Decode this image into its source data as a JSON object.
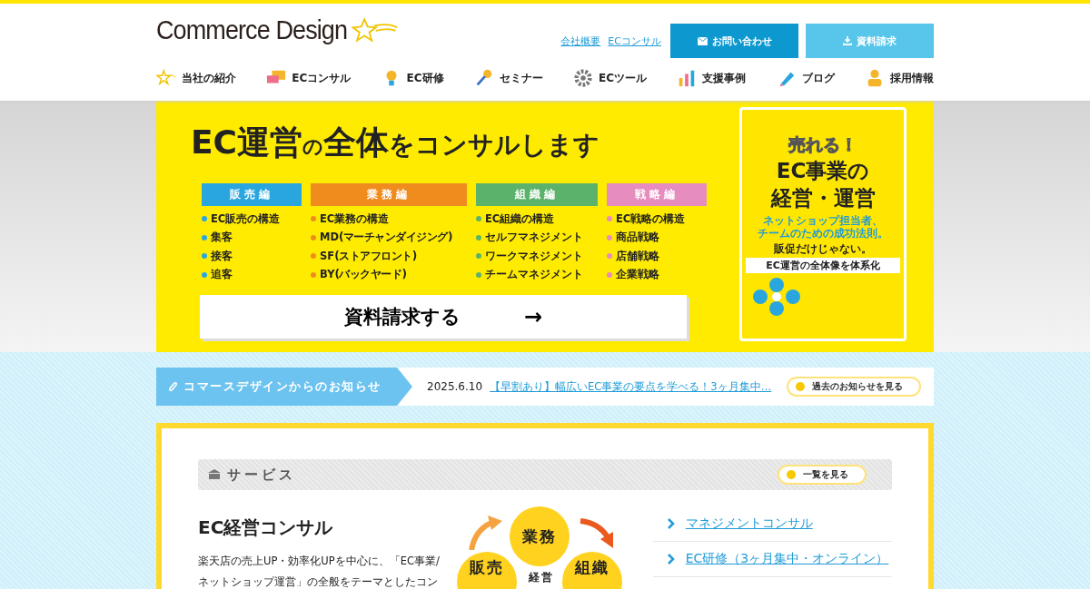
{
  "header": {
    "logo": "Commerce Design",
    "top_links": [
      "会社概要",
      "ECコンサル"
    ],
    "buttons": [
      {
        "label": "お問い合わせ",
        "kind": "contact"
      },
      {
        "label": "資料請求",
        "kind": "download"
      }
    ],
    "nav": [
      {
        "label": "当社の紹介",
        "kind": "star"
      },
      {
        "label": "ECコンサル",
        "kind": "chat"
      },
      {
        "label": "EC研修",
        "kind": "bulb"
      },
      {
        "label": "セミナー",
        "kind": "mic"
      },
      {
        "label": "ECツール",
        "kind": "gear"
      },
      {
        "label": "支援事例",
        "kind": "bars"
      },
      {
        "label": "ブログ",
        "kind": "pen"
      },
      {
        "label": "採用情報",
        "kind": "person"
      }
    ]
  },
  "hero": {
    "headline": [
      {
        "text": "EC運営",
        "kind": "large"
      },
      {
        "text": "の",
        "kind": "small"
      },
      {
        "text": "全体",
        "kind": "large"
      },
      {
        "text": "をコンサルします",
        "kind": "medium"
      }
    ],
    "columns": [
      {
        "title": "販売編",
        "color": "#2aa6df",
        "items": [
          {
            "text": "EC販売の構造"
          },
          {
            "text": "集客"
          },
          {
            "text": "接客"
          },
          {
            "text": "追客"
          }
        ]
      },
      {
        "title": "業務編",
        "color": "#f08c1e",
        "items": [
          {
            "text": "EC業務の構造"
          },
          {
            "text": "MD",
            "note": "(マーチャンダイジング)"
          },
          {
            "text": "SF",
            "note": "(ストアフロント)"
          },
          {
            "text": "BY",
            "note": "(バックヤード)"
          }
        ]
      },
      {
        "title": "組織編",
        "color": "#5bb26a",
        "items": [
          {
            "text": "EC組織の構造"
          },
          {
            "text": "セルフマネジメント"
          },
          {
            "text": "ワークマネジメント"
          },
          {
            "text": "チームマネジメント"
          }
        ]
      },
      {
        "title": "戦略編",
        "color": "#e68cbf",
        "items": [
          {
            "text": "EC戦略の構造"
          },
          {
            "text": "商品戦略"
          },
          {
            "text": "店舗戦略"
          },
          {
            "text": "企業戦略"
          }
        ]
      }
    ],
    "cta": "資料請求する",
    "cta_arrow": "→",
    "book": {
      "kicker": "売れる！",
      "title_lines": [
        "EC事業の",
        "経営・運営"
      ],
      "tagline_lines": [
        "ネットショップ担当者、",
        "チームのための成功法則。"
      ],
      "lead": "販促だけじゃない。",
      "banner": "EC運営の全体像を体系化"
    }
  },
  "news": {
    "label": "コマースデザインからのお知らせ",
    "date": "2025.6.10",
    "link": "【早割あり】幅広いEC事業の要点を学べる！3ヶ月集中…",
    "button": "過去のお知らせを見る"
  },
  "services": {
    "heading": "サービス",
    "button": "一覧を見る",
    "title": "EC経営コンサル",
    "description": "楽天店の売上UP・効率化UPを中心に、「EC事業/ネットショップ運営」の全般をテーマとしたコン",
    "diagram": [
      "業務",
      "販売",
      "経営",
      "組織"
    ],
    "links": [
      "マネジメントコンサル",
      "EC研修（3ヶ月集中・オンライン）"
    ]
  }
}
